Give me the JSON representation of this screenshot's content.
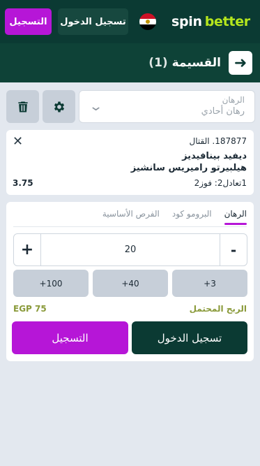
{
  "header": {
    "register_label": "التسجيل",
    "login_label": "تسجيل الدخول",
    "logo_spin": "spin",
    "logo_better": "better",
    "flag_icon": "egypt-flag-icon"
  },
  "slip": {
    "title": "القسيمة",
    "count": "(1)",
    "back_icon": "arrow-right-icon"
  },
  "bet_type": {
    "label": "الرهان",
    "value": "رهان أحادي"
  },
  "toolbar": {
    "settings_icon": "gear-icon",
    "delete_icon": "trash-icon"
  },
  "bet": {
    "event": "187877. القتال",
    "player1": "ديفيد بينافيديز",
    "player2": "هيلبيرتو راميريس سانشيز",
    "outcome": "1تعادل2: فوز2",
    "odds": "3.75"
  },
  "stake": {
    "tabs": [
      {
        "label": "الرهان",
        "active": true
      },
      {
        "label": "البرومو كود",
        "active": false
      },
      {
        "label": "الفرص الأساسية",
        "active": false
      }
    ],
    "minus": "-",
    "plus": "+",
    "amount": "20",
    "quick": [
      "+3",
      "+40",
      "+100"
    ],
    "potential_label": "الربح المحتمل",
    "potential_value": "EGP 75",
    "login_label": "تسجيل الدخول",
    "register_label": "التسجيل"
  },
  "colors": {
    "brand_dark": "#0b3a33",
    "accent_purple": "#b616d7",
    "logo_green": "#b5e61d"
  }
}
